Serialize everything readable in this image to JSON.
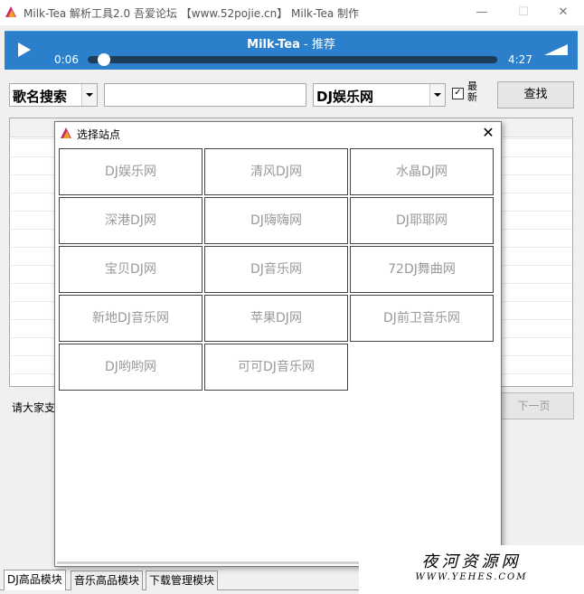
{
  "window": {
    "title": "Milk-Tea 解析工具2.0   吾爱论坛 【www.52pojie.cn】 Milk-Tea 制作",
    "minimize_glyph": "—",
    "maximize_glyph": "☐",
    "close_glyph": "✕"
  },
  "player": {
    "title": "Milk-Tea",
    "subtitle": " - 推荐",
    "current_time": "0:06",
    "total_time": "4:27",
    "progress": 0.02
  },
  "toolbar": {
    "search_type": "歌名搜索",
    "search_value": "",
    "site": "DJ娱乐网",
    "latest_checked": true,
    "latest_label": "最新",
    "find_label": "查找"
  },
  "status": {
    "text": "请大家支",
    "next_label": "下一页"
  },
  "tabs": [
    {
      "label": "DJ高品模块"
    },
    {
      "label": "音乐高品模块"
    },
    {
      "label": "下载管理模块"
    }
  ],
  "dialog": {
    "title": "选择站点",
    "close_glyph": "✕",
    "sites": [
      "DJ娱乐网",
      "清风DJ网",
      "水晶DJ网",
      "深港DJ网",
      "DJ嗨嗨网",
      "DJ耶耶网",
      "宝贝DJ网",
      "DJ音乐网",
      "72DJ舞曲网",
      "新地DJ音乐网",
      "苹果DJ网",
      "DJ前卫音乐网",
      "DJ哟哟网",
      "可可DJ音乐网"
    ]
  },
  "watermark": {
    "title": "夜河资源网",
    "subtitle": "WWW.YEHES.COM"
  },
  "colors": {
    "player_bg": "#2b7fcb",
    "site_text": "#999999"
  }
}
